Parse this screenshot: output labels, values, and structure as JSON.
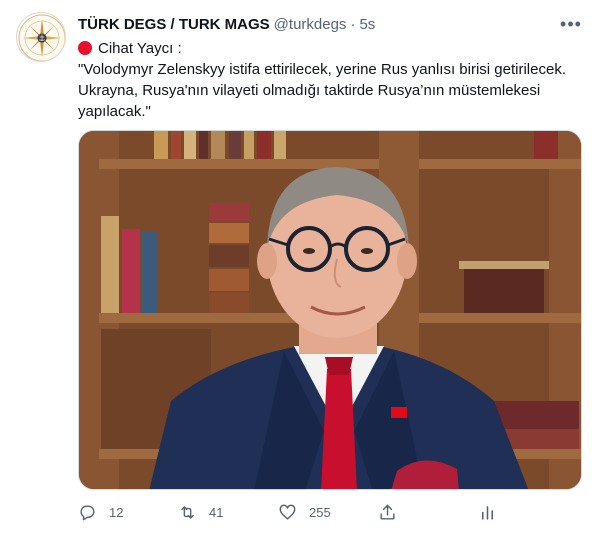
{
  "account": {
    "name": "TÜRK DEGS / TURK MAGS",
    "handle": "@turkdegs",
    "separator": "·",
    "time": "5s"
  },
  "menu": {
    "more_icon": "more-horizontal-icon",
    "label": "•••"
  },
  "tweet": {
    "line1": "Cihat Yaycı :",
    "line2": "\"Volodymyr Zelenskyy istifa ettirilecek, yerine Rus yanlısı birisi getirilecek. Ukrayna, Rusya'nın vilayeti olmadığı taktirde Rusya’nın müstemlekesi yapılacak.\""
  },
  "actions": {
    "reply": {
      "icon": "reply-icon",
      "count": "12"
    },
    "retweet": {
      "icon": "retweet-icon",
      "count": "41"
    },
    "like": {
      "icon": "heart-icon",
      "count": "255"
    },
    "share": {
      "icon": "share-icon"
    },
    "analytics": {
      "icon": "analytics-icon"
    }
  },
  "colors": {
    "text": "#0f1419",
    "secondary": "#536471",
    "red_dot": "#e8102d"
  }
}
